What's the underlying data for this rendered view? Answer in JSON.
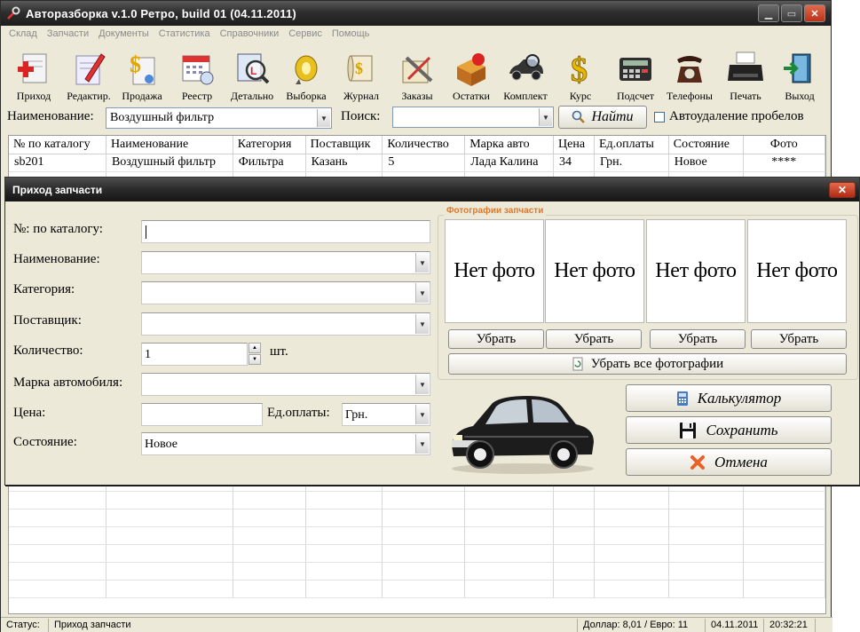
{
  "window": {
    "title": "Авторазборка v.1.0 Ретро, build 01 (04.11.2011)"
  },
  "menu": [
    "Склад",
    "Запчасти",
    "Документы",
    "Статистика",
    "Справочники",
    "Сервис",
    "Помощь"
  ],
  "toolbar": [
    {
      "label": "Приход",
      "icon": "add-part-icon"
    },
    {
      "label": "Редактир.",
      "icon": "edit-document-icon"
    },
    {
      "label": "Продажа",
      "icon": "sale-dollar-icon"
    },
    {
      "label": "Реестр",
      "icon": "calendar-register-icon"
    },
    {
      "label": "Детально",
      "icon": "magnifier-detail-icon"
    },
    {
      "label": "Выборка",
      "icon": "selection-key-icon"
    },
    {
      "label": "Журнал",
      "icon": "journal-scroll-icon"
    },
    {
      "label": "Заказы",
      "icon": "orders-tools-icon"
    },
    {
      "label": "Остатки",
      "icon": "stock-boxes-icon"
    },
    {
      "label": "Комплект",
      "icon": "car-search-icon"
    },
    {
      "label": "Курс",
      "icon": "exchange-rate-dollar-icon"
    },
    {
      "label": "Подсчет",
      "icon": "calculator-icon"
    },
    {
      "label": "Телефоны",
      "icon": "telephone-icon"
    },
    {
      "label": "Печать",
      "icon": "typewriter-icon"
    },
    {
      "label": "Выход",
      "icon": "exit-door-icon"
    }
  ],
  "filter": {
    "name_label": "Наименование:",
    "name_value": "Воздушный фильтр",
    "search_label": "Поиск:",
    "search_value": "",
    "find_button": "Найти",
    "auto_trim_label": "Автоудаление пробелов"
  },
  "grid": {
    "columns": [
      "№ по каталогу",
      "Наименование",
      "Категория",
      "Поставщик",
      "Количество",
      "Марка авто",
      "Цена",
      "Ед.оплаты",
      "Состояние",
      "Фото"
    ],
    "rows": [
      [
        "sb201",
        "Воздушный фильтр",
        "Фильтра",
        "Казань",
        "5",
        "Лада Калина",
        "34",
        "Грн.",
        "Новое",
        "****"
      ]
    ]
  },
  "dialog": {
    "title": "Приход запчасти",
    "labels": {
      "catalog": "№: по каталогу:",
      "name": "Наименование:",
      "category": "Категория:",
      "supplier": "Поставщик:",
      "quantity": "Количество:",
      "car_brand": "Марка автомобиля:",
      "price": "Цена:",
      "payment_unit": "Ед.оплаты:",
      "state": "Состояние:"
    },
    "values": {
      "catalog": "",
      "name": "",
      "category": "",
      "supplier": "",
      "quantity": "1",
      "quantity_unit": "шт.",
      "car_brand": "",
      "price": "",
      "payment_unit": "Грн.",
      "state": "Новое"
    },
    "photos": {
      "legend": "Фотографии запчасти",
      "placeholders": [
        "Нет фото",
        "Нет фото",
        "Нет фото",
        "Нет фото"
      ],
      "remove_buttons": [
        "Убрать",
        "Убрать",
        "Убрать",
        "Убрать"
      ],
      "remove_all": "Убрать все фотографии"
    },
    "buttons": {
      "calculator": "Калькулятор",
      "save": "Сохранить",
      "cancel": "Отмена"
    }
  },
  "status": {
    "label": "Статус:",
    "value": "Приход запчасти",
    "rates": "Доллар: 8,01 / Евро: 11",
    "date": "04.11.2011",
    "time": "20:32:21"
  },
  "colors": {
    "legend_orange": "#e0782a",
    "title_dark": "#2a2a2a",
    "panel": "#ece9d8"
  }
}
